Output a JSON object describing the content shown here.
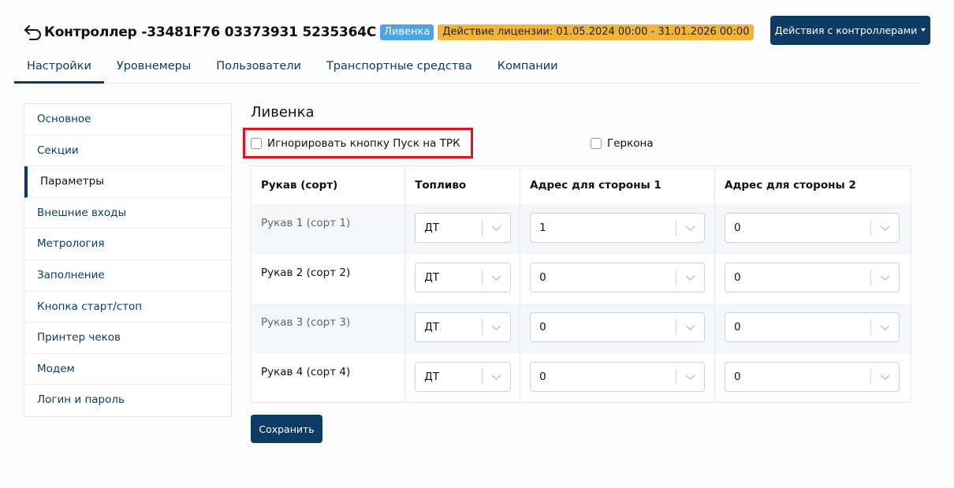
{
  "header": {
    "title": "Контроллер -33481F76 03373931 5235364C",
    "badge": "Ливенка",
    "license": "Действие лицензии: 01.05.2024 00:00 - 31.01.2026 00:00",
    "actions_label": "Действия с контроллерами",
    "back_icon": "back-arrow-icon"
  },
  "tabs": [
    {
      "label": "Настройки",
      "active": true
    },
    {
      "label": "Уровнемеры"
    },
    {
      "label": "Пользователи"
    },
    {
      "label": "Транспортные средства"
    },
    {
      "label": "Компании"
    }
  ],
  "sidebar": {
    "items": [
      {
        "label": "Основное"
      },
      {
        "label": "Секции"
      },
      {
        "label": "Параметры",
        "active": true
      },
      {
        "label": "Внешние входы"
      },
      {
        "label": "Метрология"
      },
      {
        "label": "Заполнение"
      },
      {
        "label": "Кнопка старт/стоп"
      },
      {
        "label": "Принтер чеков"
      },
      {
        "label": "Модем"
      },
      {
        "label": "Логин и пароль"
      }
    ]
  },
  "main": {
    "title": "Ливенка",
    "checkbox_ignore": {
      "label": "Игнорировать кнопку Пуск на ТРК",
      "checked": false
    },
    "checkbox_gerkon": {
      "label": "Геркона",
      "checked": false
    },
    "table": {
      "headers": [
        "Рукав (сорт)",
        "Топливо",
        "Адрес для стороны 1",
        "Адрес для стороны 2"
      ],
      "rows": [
        {
          "hose": "Рукав 1 (сорт 1)",
          "fuel": "ДТ",
          "addr1": "1",
          "addr2": "0"
        },
        {
          "hose": "Рукав 2 (сорт 2)",
          "fuel": "ДТ",
          "addr1": "0",
          "addr2": "0"
        },
        {
          "hose": "Рукав 3 (сорт 3)",
          "fuel": "ДТ",
          "addr1": "0",
          "addr2": "0"
        },
        {
          "hose": "Рукав 4 (сорт 4)",
          "fuel": "ДТ",
          "addr1": "0",
          "addr2": "0"
        }
      ]
    },
    "save_label": "Сохранить"
  },
  "colors": {
    "primary": "#0d3b66",
    "badge_blue": "#4da3e8",
    "badge_orange": "#f0b43a",
    "highlight_red": "#e0141e"
  }
}
